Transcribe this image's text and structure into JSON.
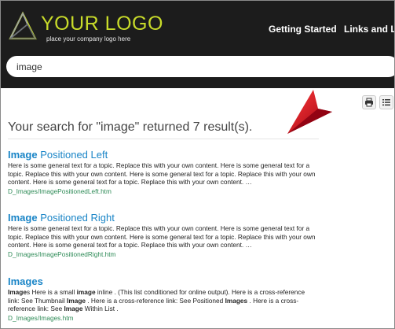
{
  "header": {
    "logo_text": "YOUR LOGO",
    "logo_tagline": "place your company logo here",
    "nav": [
      "Getting Started",
      "Links and Lis"
    ]
  },
  "search": {
    "value": "image"
  },
  "toolbar": {
    "icons": [
      "print-icon",
      "list-icon"
    ]
  },
  "results": {
    "summary": "Your search for \"image\" returned 7 result(s).",
    "items": [
      {
        "title_bold": "Image",
        "title_rest": " Positioned Left",
        "snippet": "Here is some general text for a topic. Replace this with your own content. Here is some general text for a topic. Replace this with your own content. Here is some general text for a topic. Replace this with your own content. Here is some general text for a topic. Replace this with your own content. …",
        "path": "D_Images/ImagePositionedLeft.htm"
      },
      {
        "title_bold": "Image",
        "title_rest": " Positioned Right",
        "snippet": "Here is some general text for a topic. Replace this with your own content. Here is some general text for a topic. Replace this with your own content. Here is some general text for a topic. Replace this with your own content. Here is some general text for a topic. Replace this with your own content. …",
        "path": "D_Images/ImagePositionedRight.htm"
      },
      {
        "title_bold": "Images",
        "title_rest": "",
        "snippet_parts": [
          "Image",
          "s Here is a small ",
          "image",
          " inline . (This list conditioned for online output). Here is a cross-reference link: See Thumbnail ",
          "Image",
          " . Here is a cross-reference link: See Positioned ",
          "Images",
          " . Here is a cross-reference link: See ",
          "Image",
          " Within List ."
        ],
        "path": "D_Images/Images.htm"
      }
    ]
  },
  "colors": {
    "header_bg": "#1c1c1c",
    "logo_accent": "#c8db2a",
    "link": "#1a85c7",
    "path": "#2e8b57",
    "pointer": "#d0021b"
  }
}
